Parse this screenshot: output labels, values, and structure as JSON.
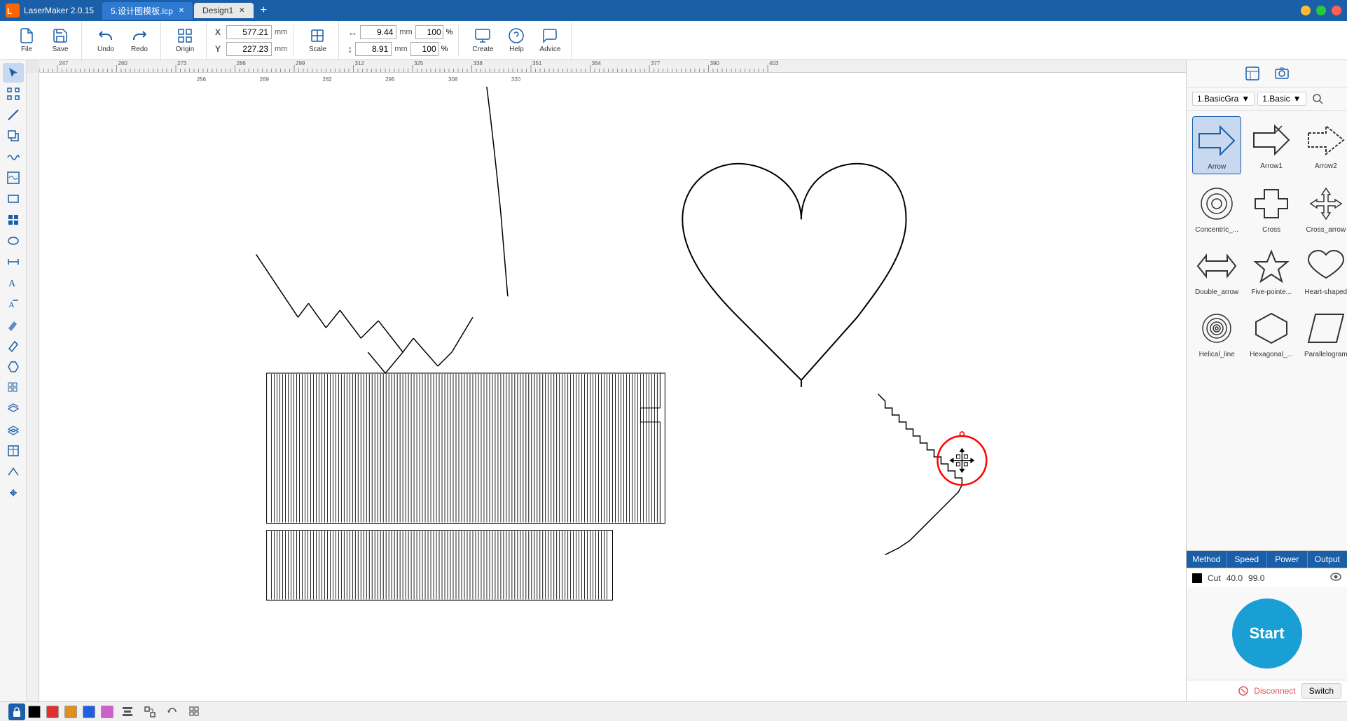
{
  "titleBar": {
    "appName": "LaserMaker 2.0.15",
    "tabs": [
      {
        "label": "5.设计图模板.lcp",
        "active": false
      },
      {
        "label": "Design1",
        "active": true
      }
    ],
    "addTab": "+"
  },
  "toolbar": {
    "file": "File",
    "save": "Save",
    "undo": "Undo",
    "redo": "Redo",
    "origin": "Origin",
    "scale": "Scale",
    "create": "Create",
    "help": "Help",
    "advice": "Advice",
    "x_label": "X",
    "y_label": "Y",
    "x_value": "577.21",
    "y_value": "227.23",
    "unit_mm": "mm",
    "width_value": "9.44",
    "height_value": "8.91",
    "width_pct": "100",
    "height_pct": "100"
  },
  "panel": {
    "dropdown1": "1.BasicGra",
    "dropdown2": "1.Basic",
    "shapes": [
      {
        "id": "arrow",
        "label": "Arrow",
        "selected": true
      },
      {
        "id": "arrow1",
        "label": "Arrow1",
        "selected": false
      },
      {
        "id": "arrow2",
        "label": "Arrow2",
        "selected": false
      },
      {
        "id": "concentric",
        "label": "Concentric_...",
        "selected": false
      },
      {
        "id": "cross",
        "label": "Cross",
        "selected": false
      },
      {
        "id": "cross_arrow",
        "label": "Cross_arrow",
        "selected": false
      },
      {
        "id": "double_arrow",
        "label": "Double_arrow",
        "selected": false
      },
      {
        "id": "five_pointed",
        "label": "Five-pointe...",
        "selected": false
      },
      {
        "id": "heart",
        "label": "Heart-shaped",
        "selected": false
      },
      {
        "id": "helical",
        "label": "Helical_line",
        "selected": false
      },
      {
        "id": "hexagonal",
        "label": "Hexagonal_...",
        "selected": false
      },
      {
        "id": "parallelogram",
        "label": "Parallelogram",
        "selected": false
      }
    ],
    "tabs": [
      "Method",
      "Speed",
      "Power",
      "Output"
    ],
    "processing": {
      "colorLabel": "■",
      "typeLabel": "Cut",
      "speed": "40.0",
      "power": "99.0"
    },
    "startLabel": "Start",
    "disconnectLabel": "Disconnect",
    "switchLabel": "Switch"
  },
  "bottomBar": {
    "colors": [
      "#000000",
      "#e03030",
      "#e09020",
      "#2060e0",
      "#cc60cc"
    ],
    "tools": [
      "align",
      "group",
      "refresh",
      "grid"
    ]
  }
}
